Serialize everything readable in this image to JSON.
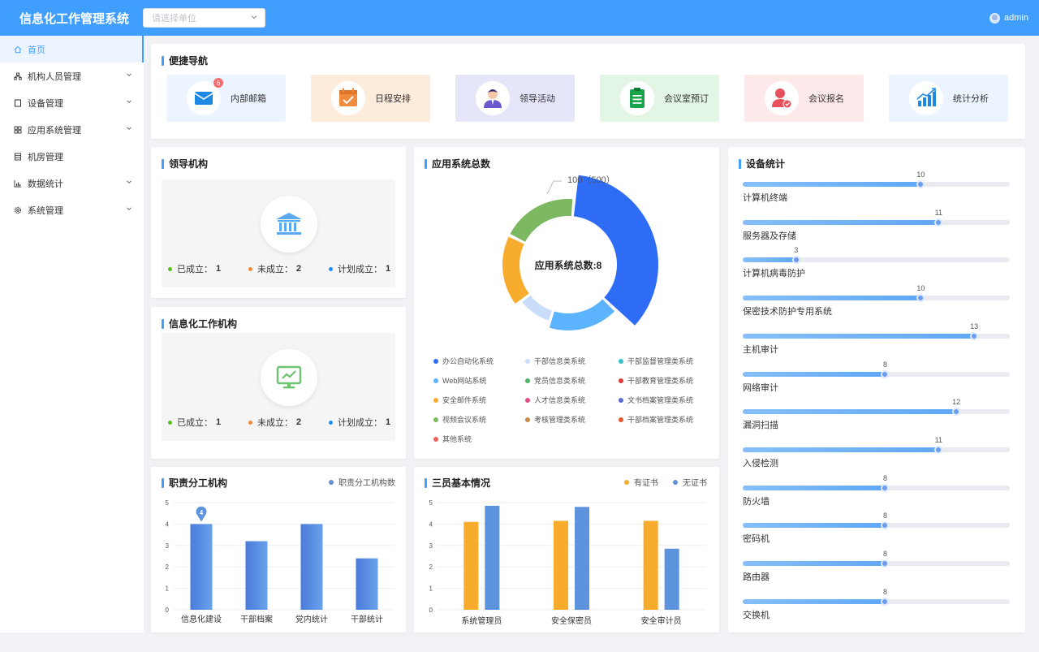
{
  "header": {
    "title": "信息化工作管理系统",
    "unit_placeholder": "请选择单位",
    "user": "admin"
  },
  "sidebar": {
    "items": [
      {
        "label": "首页",
        "icon": "home-icon",
        "active": true,
        "expandable": false
      },
      {
        "label": "机构人员管理",
        "icon": "org-icon",
        "active": false,
        "expandable": true
      },
      {
        "label": "设备管理",
        "icon": "device-icon",
        "active": false,
        "expandable": true
      },
      {
        "label": "应用系统管理",
        "icon": "apps-icon",
        "active": false,
        "expandable": true
      },
      {
        "label": "机房管理",
        "icon": "server-room-icon",
        "active": false,
        "expandable": false
      },
      {
        "label": "数据统计",
        "icon": "chart-icon",
        "active": false,
        "expandable": true
      },
      {
        "label": "系统管理",
        "icon": "settings-icon",
        "active": false,
        "expandable": true
      }
    ]
  },
  "quick_nav": {
    "title": "便捷导航",
    "items": [
      {
        "label": "内部邮箱",
        "icon": "mail-icon",
        "badge": "6",
        "bg": "#ecf4ff",
        "color": "#1e88e5"
      },
      {
        "label": "日程安排",
        "icon": "calendar-icon",
        "badge": "",
        "bg": "#fdebdc",
        "color": "#f08a3c"
      },
      {
        "label": "领导活动",
        "icon": "leader-icon",
        "badge": "",
        "bg": "#e6e6fb",
        "color": "#6a5acd"
      },
      {
        "label": "会议室预订",
        "icon": "clipboard-icon",
        "badge": "",
        "bg": "#e3f6e6",
        "color": "#1aa34a"
      },
      {
        "label": "会议报名",
        "icon": "user-check-icon",
        "badge": "",
        "bg": "#fde9ea",
        "color": "#e8505b"
      },
      {
        "label": "统计分析",
        "icon": "bar-chart-icon",
        "badge": "",
        "bg": "#ecf4ff",
        "color": "#1e88e5"
      }
    ]
  },
  "leadership": {
    "title": "领导机构",
    "icon": "bank-icon",
    "stats": [
      {
        "label": "已成立：",
        "value": "1",
        "color": "#52c41a"
      },
      {
        "label": "未成立：",
        "value": "2",
        "color": "#f08a3c"
      },
      {
        "label": "计划成立：",
        "value": "1",
        "color": "#1890ff"
      }
    ]
  },
  "info_org": {
    "title": "信息化工作机构",
    "icon": "monitor-icon",
    "stats": [
      {
        "label": "已成立：",
        "value": "1",
        "color": "#52c41a"
      },
      {
        "label": "未成立：",
        "value": "2",
        "color": "#f08a3c"
      },
      {
        "label": "计划成立：",
        "value": "1",
        "color": "#1890ff"
      }
    ]
  },
  "app_systems": {
    "title": "应用系统总数",
    "center_label": "应用系统总数:8",
    "callout": "100（500）",
    "legend": [
      {
        "label": "办公自动化系统",
        "color": "#2f6cf6"
      },
      {
        "label": "干部信息类系统",
        "color": "#c9dcfa"
      },
      {
        "label": "干部监督管理类系统",
        "color": "#36c3c9"
      },
      {
        "label": "Web网站系统",
        "color": "#5cb3ff"
      },
      {
        "label": "党员信息类系统",
        "color": "#52b36b"
      },
      {
        "label": "干部教育管理类系统",
        "color": "#e03b3b"
      },
      {
        "label": "安全邮件系统",
        "color": "#f7ac2e"
      },
      {
        "label": "人才信息类系统",
        "color": "#e64c8a"
      },
      {
        "label": "文书档案管理类系统",
        "color": "#5b6bd6"
      },
      {
        "label": "视频会议系统",
        "color": "#7cb860"
      },
      {
        "label": "考核管理类系统",
        "color": "#c98a4b"
      },
      {
        "label": "干部档案管理类系统",
        "color": "#e8572a"
      },
      {
        "label": "其他系统",
        "color": "#f0605a"
      }
    ]
  },
  "equipment": {
    "title": "设备统计",
    "max": 15,
    "items": [
      {
        "label": "计算机终端",
        "value": 10
      },
      {
        "label": "服务器及存储",
        "value": 11
      },
      {
        "label": "计算机病毒防护",
        "value": 3
      },
      {
        "label": "保密技术防护专用系统",
        "value": 10
      },
      {
        "label": "主机审计",
        "value": 13
      },
      {
        "label": "网络审计",
        "value": 8
      },
      {
        "label": "漏洞扫描",
        "value": 12
      },
      {
        "label": "入侵检测",
        "value": 11
      },
      {
        "label": "防火墙",
        "value": 8
      },
      {
        "label": "密码机",
        "value": 8
      },
      {
        "label": "路由器",
        "value": 8
      },
      {
        "label": "交换机",
        "value": 8
      }
    ]
  },
  "chart_data": [
    {
      "type": "pie",
      "title": "应用系统总数",
      "categories": [
        "办公自动化系统",
        "Web网站系统",
        "干部信息类系统",
        "安全邮件系统",
        "视频会议系统"
      ],
      "values": [
        3,
        1.5,
        0.8,
        1.5,
        1.6
      ],
      "colors": [
        "#2f6cf6",
        "#5cb3ff",
        "#c9dcfa",
        "#f7ac2e",
        "#7cb860"
      ]
    },
    {
      "type": "bar",
      "title": "职责分工机构",
      "categories": [
        "信息化建设",
        "干部档案",
        "党内统计",
        "干部统计"
      ],
      "series": [
        {
          "name": "职责分工机构数",
          "values": [
            4,
            3.2,
            4,
            2.4
          ]
        }
      ],
      "ylim": [
        0,
        5
      ],
      "yticks": [
        0,
        1,
        2,
        3,
        4,
        5
      ],
      "marker_label": "4"
    },
    {
      "type": "bar",
      "title": "三员基本情况",
      "categories": [
        "系统管理员",
        "安全保密员",
        "安全审计员"
      ],
      "series": [
        {
          "name": "有证书",
          "values": [
            4.1,
            4.15,
            4.15
          ],
          "color": "#f7ac2e"
        },
        {
          "name": "无证书",
          "values": [
            4.85,
            4.8,
            2.85
          ],
          "color": "#5c93dc"
        }
      ],
      "ylim": [
        0,
        5
      ],
      "yticks": [
        0,
        1,
        2,
        3,
        4,
        5
      ]
    }
  ]
}
